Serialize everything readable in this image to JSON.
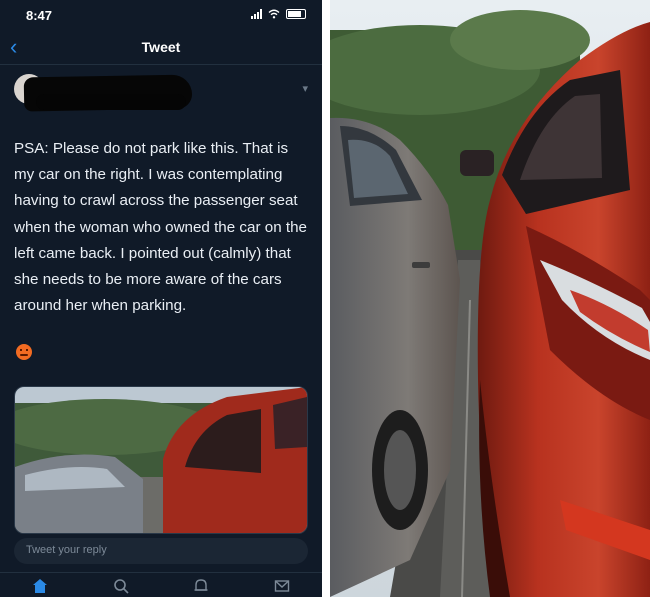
{
  "status_bar": {
    "time": "8:47"
  },
  "nav": {
    "title": "Tweet",
    "back_icon": "chevron-left-icon"
  },
  "tweet": {
    "text": "PSA: Please do not park like this. That is my car on the right. I was contemplating having to crawl across the passenger seat when the woman who owned the car on the left came back. I pointed out (calmly) that she needs to be more aware of the cars around her when parking."
  },
  "reply": {
    "placeholder": "Tweet your reply"
  },
  "tabbar": {
    "icons": [
      "home-icon",
      "search-icon",
      "notifications-icon",
      "messages-icon"
    ]
  },
  "colors": {
    "accent": "#2b8ae6",
    "background": "#101a28",
    "red_car": "#b8321f"
  }
}
